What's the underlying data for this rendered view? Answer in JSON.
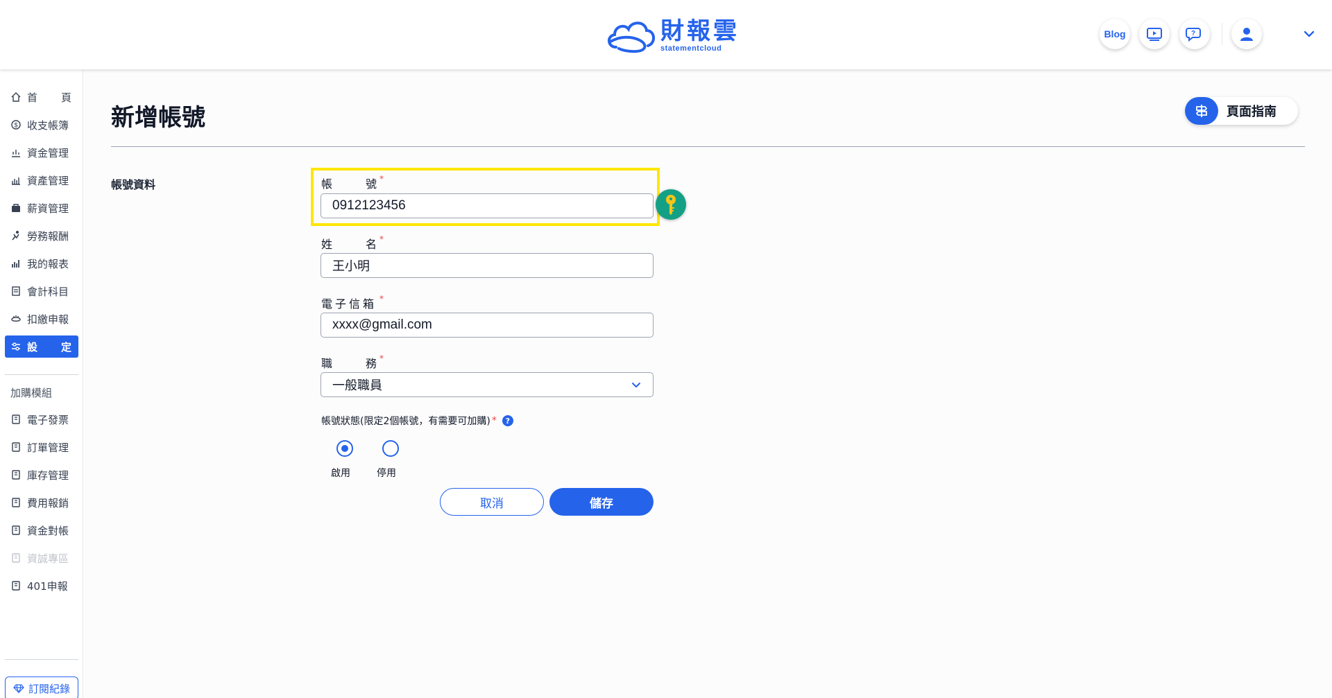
{
  "brand": {
    "name_cn": "財報雲",
    "name_en": "statementcloud"
  },
  "header": {
    "blog_label": "Blog",
    "icons": [
      "video-guide-icon",
      "help-chat-icon",
      "user-icon",
      "chevron-down-icon"
    ]
  },
  "sidebar": {
    "items": [
      {
        "label": "首頁",
        "chars": [
          "首",
          "頁"
        ],
        "icon": "home-icon"
      },
      {
        "label": "收支帳簿",
        "icon": "coin-icon"
      },
      {
        "label": "資金管理",
        "icon": "fund-icon"
      },
      {
        "label": "資產管理",
        "icon": "asset-icon"
      },
      {
        "label": "薪資管理",
        "icon": "salary-icon"
      },
      {
        "label": "勞務報酬",
        "icon": "labor-icon"
      },
      {
        "label": "我的報表",
        "icon": "report-icon"
      },
      {
        "label": "會計科目",
        "icon": "ledger-icon"
      },
      {
        "label": "扣繳申報",
        "icon": "tax-icon"
      },
      {
        "label": "設定",
        "chars": [
          "設",
          "定"
        ],
        "icon": "settings-sliders-icon",
        "active": true
      }
    ],
    "addon_title": "加購模組",
    "addons": [
      {
        "label": "電子發票"
      },
      {
        "label": "訂單管理"
      },
      {
        "label": "庫存管理"
      },
      {
        "label": "費用報銷"
      },
      {
        "label": "資金對帳"
      },
      {
        "label": "資誠專區",
        "disabled": true
      },
      {
        "label": "401申報"
      }
    ],
    "subscription_label": "訂閱紀錄"
  },
  "page": {
    "title": "新增帳號",
    "guide_label": "頁面指南",
    "section_label": "帳號資料"
  },
  "form": {
    "account": {
      "label_chars": [
        "帳",
        "號"
      ],
      "value": "0912123456",
      "required_mark": "*"
    },
    "name": {
      "label_chars": [
        "姓",
        "名"
      ],
      "value": "王小明",
      "required_mark": "*"
    },
    "email": {
      "label": "電子信箱",
      "value": "xxxx@gmail.com",
      "required_mark": "*"
    },
    "role": {
      "label_chars": [
        "職",
        "務"
      ],
      "value": "一般職員",
      "required_mark": "*"
    },
    "status": {
      "label": "帳號狀態(限定2個帳號，有需要可加購)",
      "required_mark": "*",
      "help": "?",
      "options": [
        {
          "label": "啟用",
          "checked": true
        },
        {
          "label": "停用",
          "checked": false
        }
      ]
    },
    "cancel_label": "取消",
    "save_label": "儲存"
  },
  "colors": {
    "primary": "#2563eb",
    "highlight": "#ffe600",
    "required": "#ef4444",
    "key_button": "#14a085"
  }
}
